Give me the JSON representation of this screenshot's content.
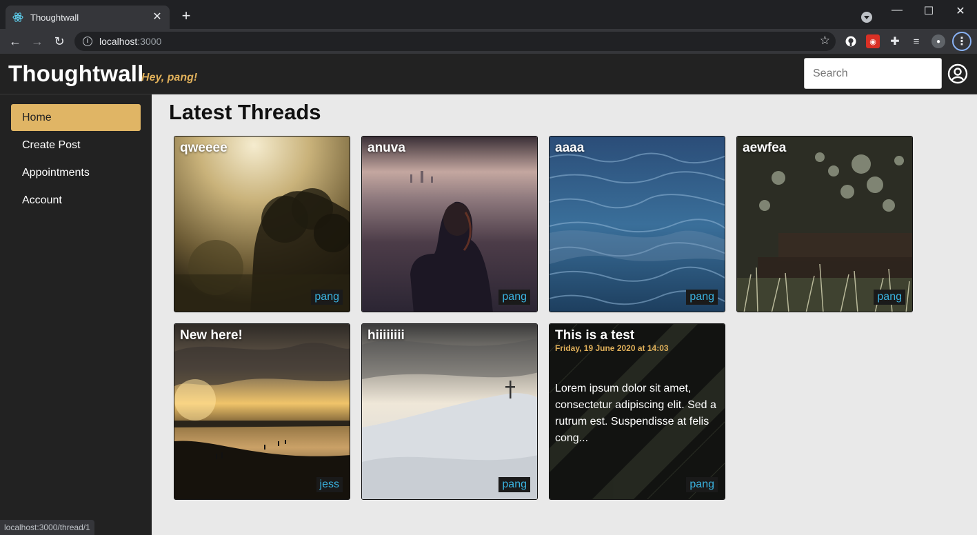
{
  "browser": {
    "tab_title": "Thoughtwall",
    "url_host": "localhost",
    "url_port": ":3000",
    "status_url": "localhost:3000/thread/1"
  },
  "app": {
    "brand": "Thoughtwall",
    "greeting": "Hey, pang!",
    "search_placeholder": "Search"
  },
  "sidebar": {
    "items": [
      {
        "label": "Home",
        "active": true
      },
      {
        "label": "Create Post",
        "active": false
      },
      {
        "label": "Appointments",
        "active": false
      },
      {
        "label": "Account",
        "active": false
      }
    ]
  },
  "main": {
    "heading": "Latest Threads",
    "threads": [
      {
        "title": "qweeee",
        "author": "pang",
        "image": "misty-tree"
      },
      {
        "title": "anuva",
        "author": "pang",
        "image": "woman-city-view"
      },
      {
        "title": "aaaa",
        "author": "pang",
        "image": "ocean-water"
      },
      {
        "title": "aewfea",
        "author": "pang",
        "image": "grass-bokeh"
      },
      {
        "title": "New here!",
        "author": "jess",
        "image": "sunset-beach"
      },
      {
        "title": "hiiiiiiii",
        "author": "pang",
        "image": "snowy-hill-cross"
      },
      {
        "title": "This is a test",
        "author": "pang",
        "date": "Friday, 19 June 2020 at 14:03",
        "excerpt": "Lorem ipsum dolor sit amet, consectetur adipiscing elit. Sed a rutrum est. Suspendisse at felis cong...",
        "image": "dark-pattern"
      }
    ]
  },
  "colors": {
    "accent": "#e0b565",
    "author_link": "#3ab3e0",
    "header_bg": "#222222",
    "content_bg": "#e9e9e9"
  }
}
